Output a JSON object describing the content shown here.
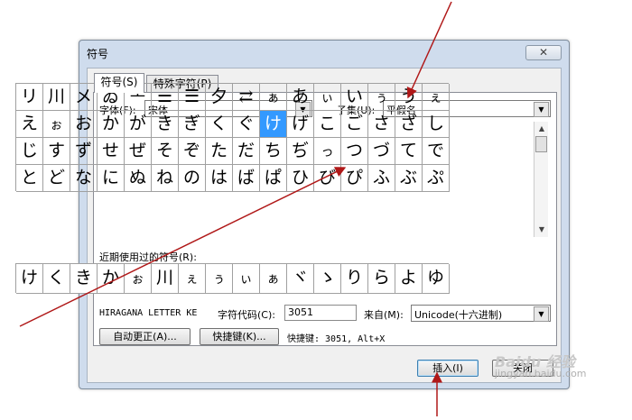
{
  "dialog": {
    "title": "符号",
    "close_label": "✕",
    "tabs": [
      {
        "label": "符号(S)"
      },
      {
        "label": "特殊字符(P)"
      }
    ]
  },
  "font": {
    "label": "字体(F):",
    "value": "宋体"
  },
  "subset": {
    "label": "子集(U):",
    "value": "平假名"
  },
  "symbol_grid": {
    "rows": [
      [
        "リ",
        "川",
        "メ",
        "ゐ",
        "ᅩ",
        "⚌",
        "☰",
        "夕",
        "⇄",
        "ぁ",
        "あ",
        "ぃ",
        "い",
        "ぅ",
        "う",
        "ぇ"
      ],
      [
        "え",
        "ぉ",
        "お",
        "か",
        "が",
        "き",
        "ぎ",
        "く",
        "ぐ",
        "け",
        "げ",
        "こ",
        "ご",
        "さ",
        "ざ",
        "し"
      ],
      [
        "じ",
        "す",
        "ず",
        "せ",
        "ぜ",
        "そ",
        "ぞ",
        "た",
        "だ",
        "ち",
        "ぢ",
        "っ",
        "つ",
        "づ",
        "て",
        "で"
      ],
      [
        "と",
        "ど",
        "な",
        "に",
        "ぬ",
        "ね",
        "の",
        "は",
        "ば",
        "ぱ",
        "ひ",
        "び",
        "ぴ",
        "ふ",
        "ぶ",
        "ぷ"
      ]
    ],
    "selected": "け"
  },
  "recent": {
    "label": "近期使用过的符号(R):",
    "chars": [
      "け",
      "く",
      "き",
      "か",
      "ぉ",
      "川",
      "ぇ",
      "ぅ",
      "ぃ",
      "ぁ",
      "ヾ",
      "ゝ",
      "り",
      "ら",
      "よ",
      "ゆ"
    ]
  },
  "info": {
    "char_name": "HIRAGANA LETTER KE",
    "code_label": "字符代码(C):",
    "code_value": "3051",
    "from_label": "来自(M):",
    "from_value": "Unicode(十六进制)"
  },
  "buttons": {
    "autocorrect": "自动更正(A)...",
    "shortcut_key": "快捷键(K)...",
    "shortcut_text": "快捷键: 3051, Alt+X",
    "insert": "插入(I)",
    "close": "关闭"
  },
  "watermark": {
    "line1": "Baidu 经验",
    "line2": "jingyan.baidu.com"
  },
  "colors": {
    "selection": "#3399ff",
    "annotation_arrow": "#b01818",
    "dialog_frame": "#cfdced"
  }
}
